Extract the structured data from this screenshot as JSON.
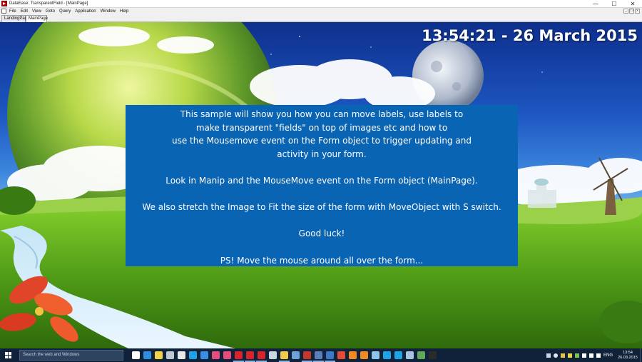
{
  "window": {
    "title": "DataEase: TransparentField - [MainPage]",
    "controls": {
      "minimize": "—",
      "maximize": "☐",
      "close": "✕"
    }
  },
  "menubar": {
    "items": [
      "File",
      "Edit",
      "View",
      "Goto",
      "Query",
      "Application",
      "Window",
      "Help"
    ],
    "mdi": {
      "minimize": "_",
      "restore": "❐",
      "close": "x"
    }
  },
  "tabs": [
    {
      "label": "LandingPage",
      "active": false
    },
    {
      "label": "MainPage",
      "active": true
    }
  ],
  "clock": "13:54:21 - 26 March 2015",
  "info_panel": {
    "lines": [
      "This sample will show you how you can move labels, use labels to",
      "make transparent \"fields\" on top of images etc and how to",
      "use the Mousemove event on the Form object to trigger updating and",
      "activity in your form.",
      "",
      "Look in Manip and the MouseMove event on the Form object (MainPage).",
      "",
      "We also stretch the Image to Fit the size of the form with MoveObject with S switch.",
      "",
      "Good luck!",
      "",
      "PS! Move the mouse around all over the form..."
    ],
    "background": "#0a64b4"
  },
  "taskbar": {
    "search_placeholder": "Search the web and Windows",
    "pinned_icons": [
      {
        "name": "task-view-icon",
        "color": "#ffffff",
        "active": false
      },
      {
        "name": "edge-browser-icon",
        "color": "#2f8ee0",
        "active": false
      },
      {
        "name": "notepad-icon",
        "color": "#f2d24a",
        "active": false
      },
      {
        "name": "pen-icon",
        "color": "#bfc7d0",
        "active": false
      },
      {
        "name": "store-icon",
        "color": "#e9e9e9",
        "active": false
      },
      {
        "name": "skype-icon",
        "color": "#1ea4e6",
        "active": false
      },
      {
        "name": "app-icon-1",
        "color": "#3a8ee6",
        "active": false
      },
      {
        "name": "app-icon-2",
        "color": "#e44e7a",
        "active": false
      },
      {
        "name": "app-icon-3",
        "color": "#e44e7a",
        "active": false
      },
      {
        "name": "dataease-icon",
        "color": "#d8242b",
        "active": true
      },
      {
        "name": "dataease-icon-2",
        "color": "#d8242b",
        "active": true
      },
      {
        "name": "dataease-icon-3",
        "color": "#d8242b",
        "active": true
      },
      {
        "name": "app-icon-4",
        "color": "#c9d6e6",
        "active": false
      },
      {
        "name": "folder-icon",
        "color": "#f0c84c",
        "active": true
      },
      {
        "name": "app-icon-5",
        "color": "#6fa0d8",
        "active": false
      },
      {
        "name": "app-icon-6",
        "color": "#c0392b",
        "active": true
      },
      {
        "name": "app-icon-7",
        "color": "#5b7fb8",
        "active": true
      },
      {
        "name": "computer-icon",
        "color": "#3e78c8",
        "active": true
      },
      {
        "name": "chrome-icon",
        "color": "#e24b3a",
        "active": false
      },
      {
        "name": "firefox-icon",
        "color": "#f08a24",
        "active": false
      },
      {
        "name": "firefox-icon-2",
        "color": "#f08a24",
        "active": false
      },
      {
        "name": "app-icon-8",
        "color": "#8fc3ea",
        "active": false
      },
      {
        "name": "skype-icon-2",
        "color": "#1ea4e6",
        "active": false
      },
      {
        "name": "skype-icon-3",
        "color": "#1ea4e6",
        "active": false
      },
      {
        "name": "app-icon-9",
        "color": "#a8c4e0",
        "active": false
      },
      {
        "name": "app-icon-10",
        "color": "#5fa85a",
        "active": false
      },
      {
        "name": "terminal-icon",
        "color": "#2b2b2b",
        "active": false
      }
    ],
    "tray": {
      "language": "ENG",
      "time": "13:54",
      "date": "26.03.2015"
    }
  }
}
